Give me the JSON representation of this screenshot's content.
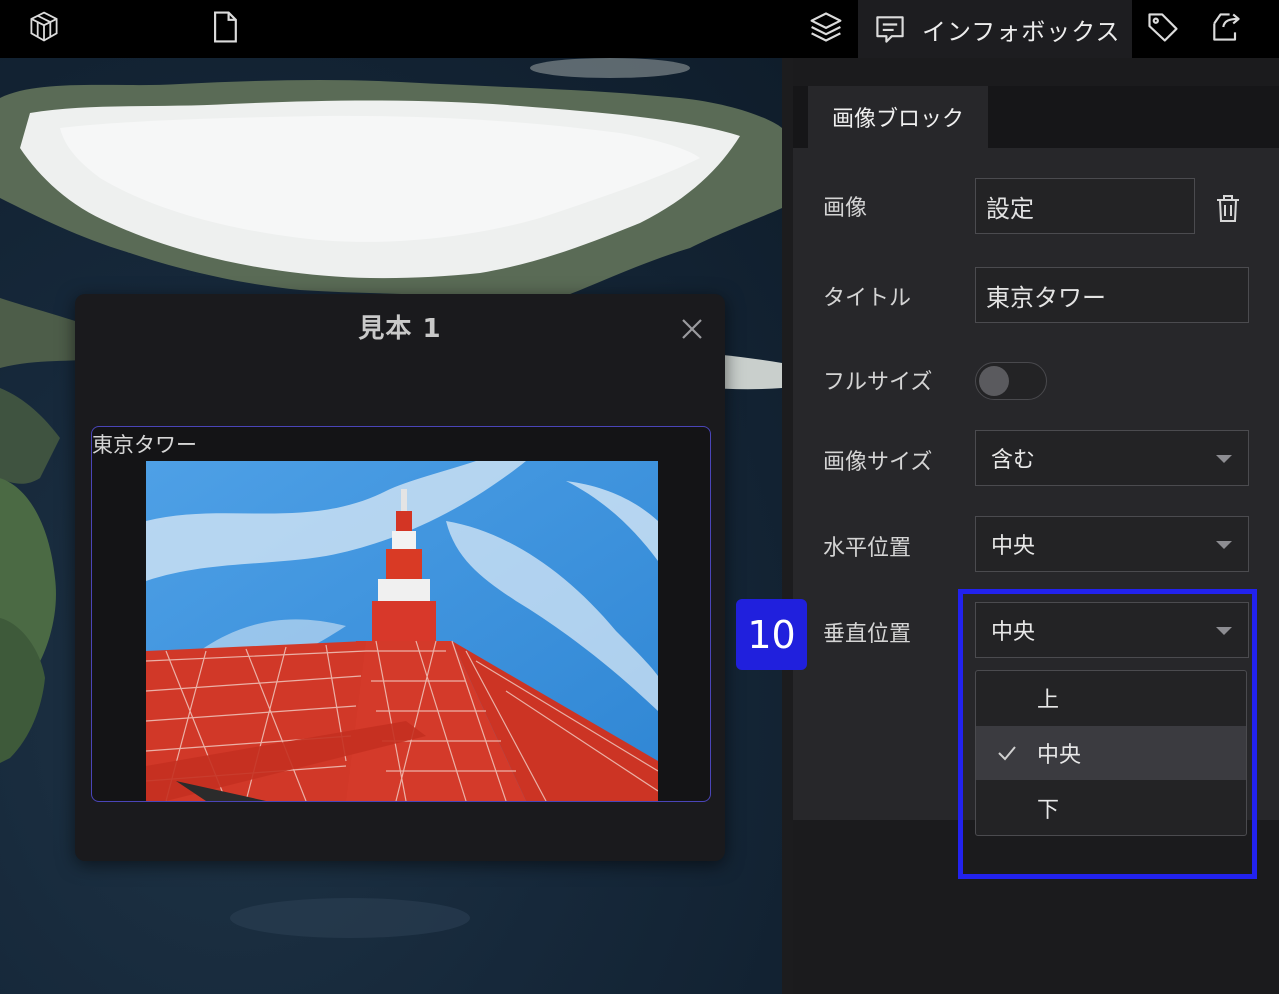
{
  "toolbar": {
    "icons": [
      "cube-icon",
      "document-icon",
      "layers-icon",
      "infobox-icon",
      "tag-icon",
      "export-icon"
    ],
    "active_tab_label": "インフォボックス"
  },
  "dialog": {
    "title": "見本 1",
    "image_block_title": "東京タワー"
  },
  "panel": {
    "tab_label": "画像ブロック",
    "fields": {
      "image": {
        "label": "画像",
        "value": "設定"
      },
      "title": {
        "label": "タイトル",
        "value": "東京タワー"
      },
      "fullsize": {
        "label": "フルサイズ",
        "enabled": false
      },
      "image_size": {
        "label": "画像サイズ",
        "value": "含む"
      },
      "horizontal": {
        "label": "水平位置",
        "value": "中央"
      },
      "vertical": {
        "label": "垂直位置",
        "value": "中央"
      }
    },
    "vertical_options": [
      {
        "label": "上",
        "selected": false
      },
      {
        "label": "中央",
        "selected": true
      },
      {
        "label": "下",
        "selected": false
      }
    ]
  },
  "annotation": {
    "step": "10",
    "color": "#2222ee"
  },
  "colors": {
    "accent": "#4a45b8",
    "background": "#1b1b1d",
    "toolbar": "#000000"
  }
}
